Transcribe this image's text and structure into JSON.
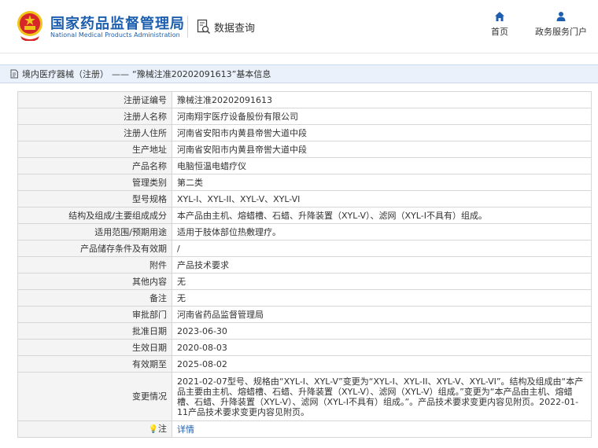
{
  "header": {
    "brand_cn": "国家药品监督管理局",
    "brand_en": "National Medical Products Administration",
    "search_label": "数据查询",
    "nav": [
      {
        "label": "首页",
        "icon": "home-icon"
      },
      {
        "label": "政务服务门户",
        "icon": "user-icon"
      }
    ]
  },
  "breadcrumb": {
    "prefix": "境内医疗器械（注册）",
    "separator": "——",
    "title": "“豫械注准20202091613”基本信息"
  },
  "colors": {
    "brand": "#1d5fae",
    "emblem_red": "#d6262a",
    "emblem_gold": "#f0c419"
  },
  "rows": [
    {
      "label": "注册证编号",
      "value": "豫械注准20202091613"
    },
    {
      "label": "注册人名称",
      "value": "河南翔宇医疗设备股份有限公司"
    },
    {
      "label": "注册人住所",
      "value": "河南省安阳市内黄县帝喾大道中段"
    },
    {
      "label": "生产地址",
      "value": "河南省安阳市内黄县帝喾大道中段"
    },
    {
      "label": "产品名称",
      "value": "电脑恒温电蜡疗仪"
    },
    {
      "label": "管理类别",
      "value": "第二类"
    },
    {
      "label": "型号规格",
      "value": "XYL-I、XYL-II、XYL-V、XYL-VI"
    },
    {
      "label": "结构及组成/主要组成成分",
      "value": "本产品由主机、熔蜡槽、石蜡、升降装置（XYL-V）、滤网（XYL-I不具有）组成。"
    },
    {
      "label": "适用范围/预期用途",
      "value": "适用于肢体部位热敷理疗。"
    },
    {
      "label": "产品储存条件及有效期",
      "value": "/"
    },
    {
      "label": "附件",
      "value": "产品技术要求"
    },
    {
      "label": "其他内容",
      "value": "无"
    },
    {
      "label": "备注",
      "value": "无"
    },
    {
      "label": "审批部门",
      "value": "河南省药品监督管理局"
    },
    {
      "label": "批准日期",
      "value": "2023-06-30"
    },
    {
      "label": "生效日期",
      "value": "2020-08-03"
    },
    {
      "label": "有效期至",
      "value": "2025-08-02"
    },
    {
      "label": "变更情况",
      "value": "2021-02-07型号、规格由“XYL-I、XYL-V”变更为“XYL-I、XYL-II、XYL-V、XYL-VI”。结构及组成由“本产品主要由主机、熔蜡槽、石蜡、升降装置（XYL-V）、滤网（XYL-V）组成。”变更为“本产品由主机、熔蜡槽、石蜡、升降装置（XYL-V）、滤网（XYL-I不具有）组成。”。产品技术要求变更内容见附页。2022-01-11产品技术要求变更内容见附页。"
    },
    {
      "label": "注",
      "value": "详情"
    }
  ]
}
